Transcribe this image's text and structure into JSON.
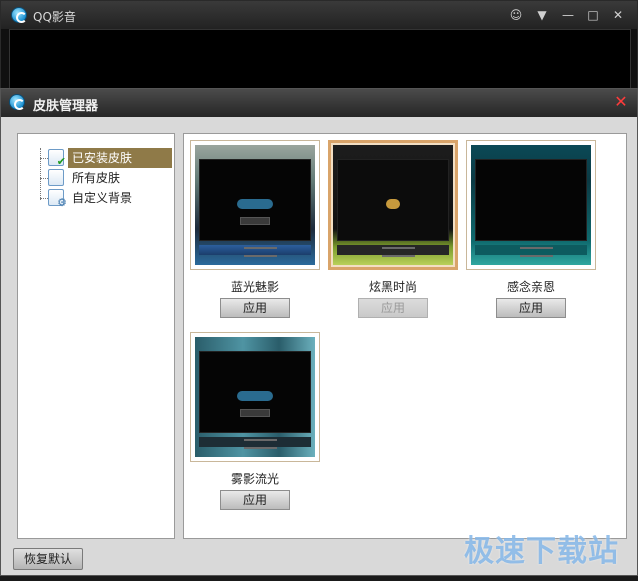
{
  "player": {
    "title": "QQ影音",
    "controls": {
      "chat": "☺",
      "menu": "▼",
      "minimize": "—",
      "maximize": "□",
      "close": "✕"
    }
  },
  "dialog": {
    "title": "皮肤管理器",
    "close": "✕"
  },
  "tree": {
    "items": [
      {
        "label": "已安装皮肤",
        "icon": "installed-skin-icon",
        "selected": true
      },
      {
        "label": "所有皮肤",
        "icon": "all-skins-icon",
        "selected": false
      },
      {
        "label": "自定义背景",
        "icon": "custom-background-icon",
        "selected": false
      }
    ]
  },
  "skins": [
    {
      "name": "蓝光魅影",
      "button": "应用",
      "selected": false,
      "disabled": false
    },
    {
      "name": "炫黑时尚",
      "button": "应用",
      "selected": true,
      "disabled": true
    },
    {
      "name": "感念亲恩",
      "button": "应用",
      "selected": false,
      "disabled": false
    },
    {
      "name": "雾影流光",
      "button": "应用",
      "selected": false,
      "disabled": false
    }
  ],
  "footer": {
    "restore_label": "恢复默认"
  },
  "watermark": "极速下载站"
}
